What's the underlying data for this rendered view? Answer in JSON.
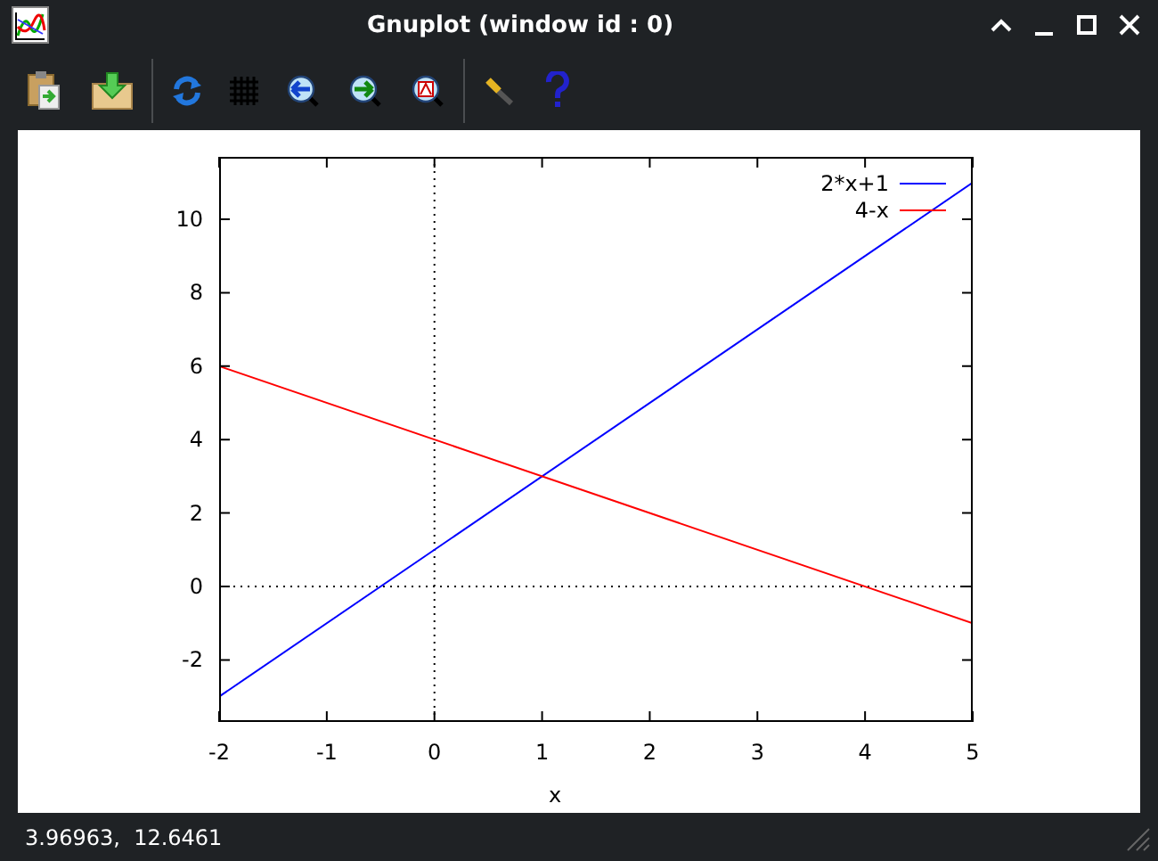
{
  "window": {
    "title": "Gnuplot (window id : 0)"
  },
  "plot": {
    "chart_data": {
      "type": "line",
      "legend": true,
      "xlabel": "x",
      "x": [
        -2,
        5
      ],
      "xlim": [
        -2,
        5
      ],
      "ylim": [
        -3.69,
        11.7
      ],
      "xticks": [
        -2,
        -1,
        0,
        1,
        2,
        3,
        4,
        5
      ],
      "yticks": [
        -2,
        0,
        2,
        4,
        6,
        8,
        10
      ],
      "series": [
        {
          "name": "2*x+1",
          "color": "#0000ff",
          "values": [
            -3,
            11
          ]
        },
        {
          "name": "4-x",
          "color": "#ff0000",
          "values": [
            6,
            -1
          ]
        }
      ]
    }
  },
  "status_bar": {
    "text": "3.96963,  12.6461"
  }
}
